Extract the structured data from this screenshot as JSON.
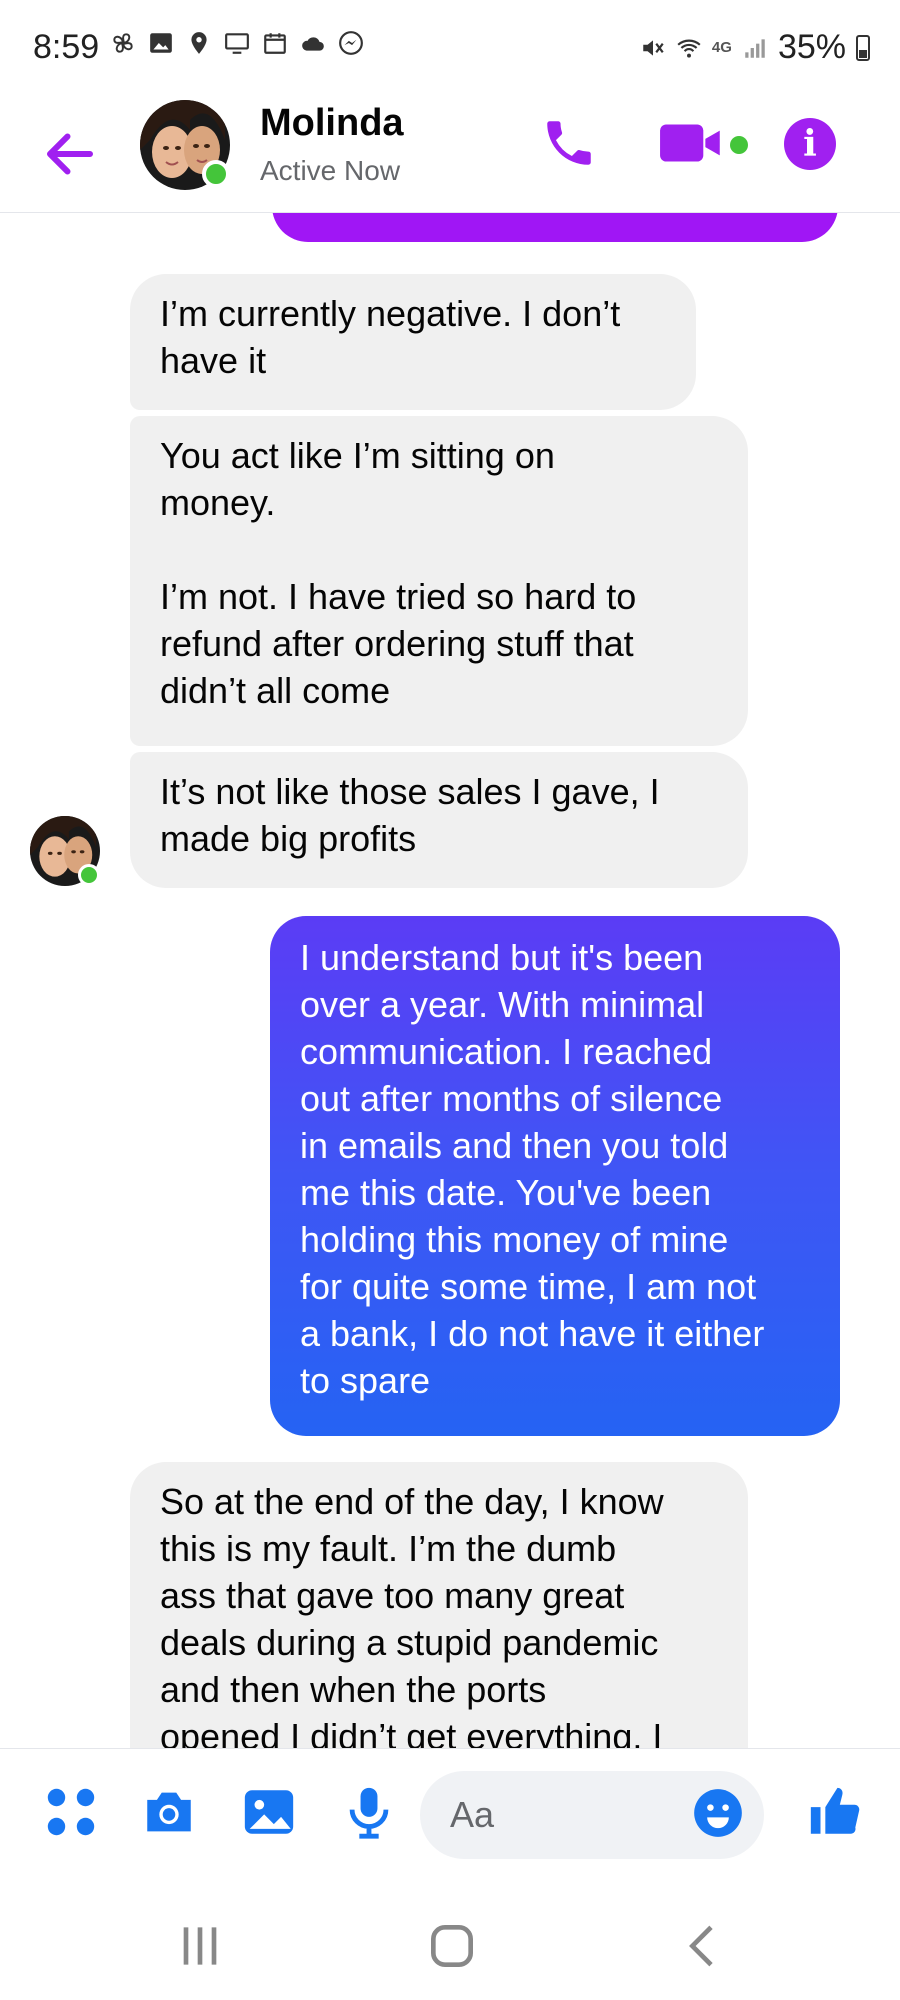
{
  "status_bar": {
    "time": "8:59",
    "battery_percent_label": "35%",
    "network_label": "4G",
    "battery_level": 0.35,
    "left_icons": [
      "fan-icon",
      "image-icon",
      "location-icon",
      "cast-icon",
      "calendar-icon",
      "cloud-icon",
      "messenger-icon"
    ],
    "right_icons": [
      "mute-icon",
      "wifi-icon",
      "lte-icon",
      "signal-icon",
      "battery-icon"
    ]
  },
  "header": {
    "contact_name": "Molinda",
    "status": "Active Now",
    "icons": [
      "back-arrow-icon",
      "phone-icon",
      "video-icon",
      "info-icon"
    ]
  },
  "messages": [
    {
      "id": "m1",
      "direction": "incoming",
      "text": "I’m currently negative. I don’t\nhave it"
    },
    {
      "id": "m2",
      "direction": "incoming",
      "text": "You act like I’m sitting on\nmoney.\n\nI’m not. I have tried so hard to\nrefund after ordering stuff that\ndidn’t all come"
    },
    {
      "id": "m3",
      "direction": "incoming",
      "text": "It’s not like those sales I gave, I\nmade big profits"
    },
    {
      "id": "m4",
      "direction": "outgoing",
      "text": "I understand but it's been\nover a year. With minimal\ncommunication. I reached\nout after months of silence\nin emails and then you told\nme this date. You've been\nholding this money of mine\nfor quite some time, I am not\na bank, I do not have it either\nto spare"
    },
    {
      "id": "m5",
      "direction": "incoming",
      "text": "So at the end of the day, I know\nthis is my fault. I’m the dumb\nass that gave too many great\ndeals during a stupid pandemic\nand then when the ports\nopened I didn’t get everything. I"
    }
  ],
  "composer": {
    "placeholder": "Aa",
    "value": "",
    "icons": [
      "apps-icon",
      "camera-icon",
      "gallery-icon",
      "microphone-icon",
      "emoji-icon",
      "thumbs-up-icon"
    ]
  },
  "nav_bar": {
    "icons": [
      "recent-apps-icon",
      "home-icon",
      "back-icon"
    ]
  },
  "colors": {
    "accent": "#a020f0",
    "incoming_bubble": "#f0f0f0",
    "outgoing_gradient_top": "#5b3cf5",
    "outgoing_gradient_bottom": "#2563f3",
    "online": "#44c53a",
    "composer_icons": "#1877f2"
  }
}
